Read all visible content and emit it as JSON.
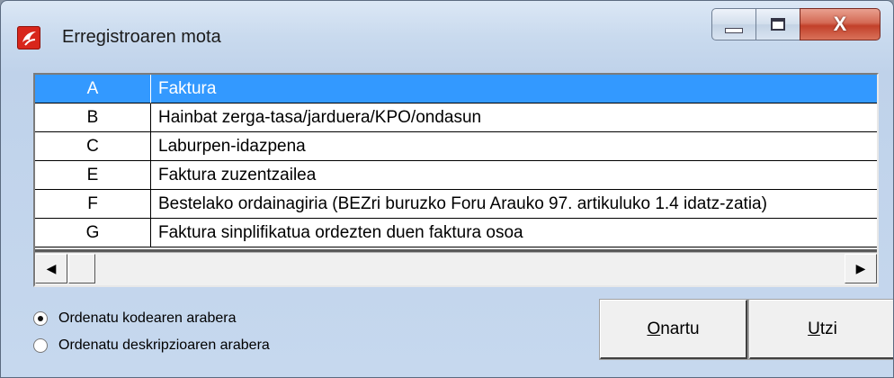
{
  "window": {
    "title": "Erregistroaren mota",
    "icon": "app-logo-icon",
    "controls": {
      "minimize": "minimize-icon",
      "maximize": "maximize-icon",
      "close": "X"
    }
  },
  "list": {
    "rows": [
      {
        "code": "A",
        "description": "Faktura",
        "selected": true
      },
      {
        "code": "B",
        "description": "Hainbat zerga-tasa/jarduera/KPO/ondasun",
        "selected": false
      },
      {
        "code": "C",
        "description": "Laburpen-idazpena",
        "selected": false
      },
      {
        "code": "E",
        "description": "Faktura zuzentzailea",
        "selected": false
      },
      {
        "code": "F",
        "description": "Bestelako ordainagiria (BEZri buruzko Foru Arauko 97. artikuluko 1.4 idatz-zatia)",
        "selected": false
      },
      {
        "code": "G",
        "description": "Faktura sinplifikatua ordezten duen faktura osoa",
        "selected": false
      }
    ],
    "scroll_left": "◀",
    "scroll_right": "▶"
  },
  "sort_options": [
    {
      "label": "Ordenatu kodearen arabera",
      "checked": true
    },
    {
      "label": "Ordenatu deskripzioaren arabera",
      "checked": false
    }
  ],
  "buttons": {
    "ok": {
      "mnemonic": "O",
      "rest": "nartu"
    },
    "cancel": {
      "mnemonic": "U",
      "rest": "tzi"
    }
  },
  "colors": {
    "selection": "#3399ff",
    "close_button": "#c2402a"
  }
}
